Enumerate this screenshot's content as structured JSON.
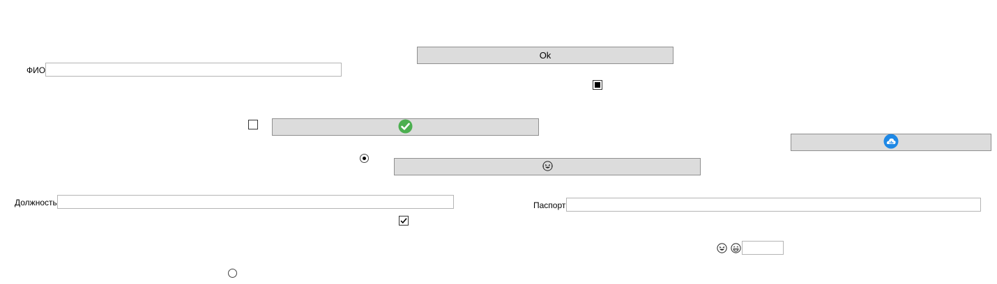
{
  "form": {
    "fio_label": "ФИО",
    "fio_value": "",
    "position_label": "Должность",
    "position_value": "",
    "passport_label": "Паспорт",
    "passport_value": "",
    "small_input_value": ""
  },
  "buttons": {
    "ok_label": "Ok",
    "check_icon": "green-check-circle-icon",
    "cloud_icon": "blue-cloud-circle-icon",
    "emoji_icon": "laughing-emoji-icon"
  },
  "controls": {
    "checkbox_top_state": "indeterminate",
    "checkbox_left_state": "unchecked",
    "checkbox_bottom_state": "checked",
    "radio_top_state": "selected",
    "radio_bottom_state": "unselected"
  },
  "icons": {
    "laugh": "laughing-emoji-icon",
    "grin": "grinning-emoji-icon"
  },
  "colors": {
    "button_bg": "#dcdcdc",
    "button_border": "#8f8f8f",
    "input_border": "#b4b4b4",
    "check_green": "#4caf50",
    "cloud_blue": "#1e88e5"
  }
}
